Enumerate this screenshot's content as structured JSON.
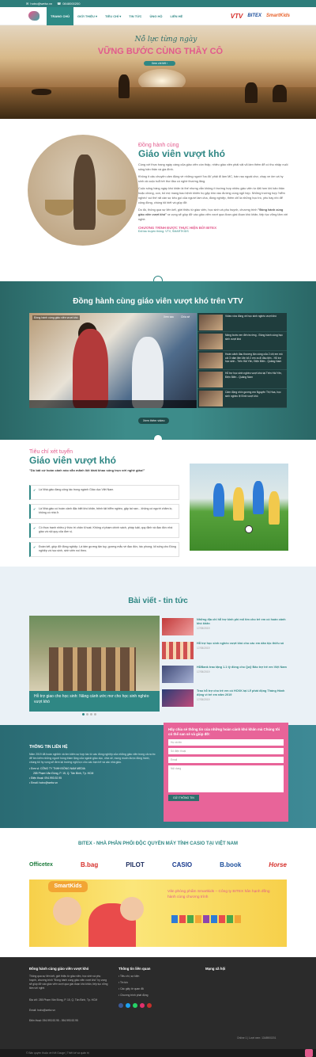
{
  "topbar": {
    "email": "hotro@webz.vn",
    "phone": "0848000200"
  },
  "nav": {
    "items": [
      "TRANG CHỦ",
      "GIỚI THIỆU ▾",
      "TIÊU CHÍ ▾",
      "TIN TỨC",
      "ỦNG HỘ",
      "LIÊN HỆ"
    ],
    "brands": [
      "VTV",
      "BITEX",
      "SmartKids"
    ]
  },
  "hero": {
    "script": "Nỗ lực từng ngày",
    "title": "VỮNG BƯỚC CÙNG THẦY CÔ",
    "button": "Xem chi tiết ›"
  },
  "intro": {
    "subtitle": "Đồng hành cùng",
    "title": "Giáo viên vượt khó",
    "p1": "Cùng với thực trạng ngày càng của giáo viên còn thấp, nhiều giáo viên phải vật vã làm thêm để có thu nhập nuôi sống bản thân và gia đình.",
    "p2": "Không ít câu chuyện cảm động về những người 'ba đô' phải đi làm MC, bán rau ngoài chợ, chạy xe ôm và hy sinh cả cuộc tuổi trẻ thơ đầu có nghề thường lãng.",
    "p3": "Cuộc sống hàng ngày khó khăn là thế nhưng vẫn không ít trường hợp nhiều giáo viên tư đất hơn khi bản thân hoặc chồng, con, bố mẹ mang bao bệnh khiến họ gặp khó vào đường cùng ngõ hẹp. Những trường hợp 'hiểm nghèo' vui thế rất cần sự kêu gọi của người làm cha, đồng nghiệp, thêm chỉ là những học trò, yêu hay nhì để cộng đồng, chúng tôi biết và giúp đỡ.",
    "p4": "Do đó, thông qua sự liên kết, giới thiệu từ giáo viên, học sinh và phụ huynh, chương trình",
    "p4b": "\"Đồng hành cùng giáo viên vượt khó\"",
    "p4c": "ra vọng sẽ giúp đỡ các giáo viên vượt qua được giai đoạn khó khăn, tiếp tục vững tâm với nghề.",
    "program": "CHƯƠNG TRÌNH ĐƯỢC THỰC HIỆN BỞI BITEX",
    "program_sub": "Đối tác truyền thông: VTV, SMARTKIDS"
  },
  "vtv": {
    "title": "Đồng hành cùng giáo viên vượt khó trên VTV",
    "video_title": "Đồng hành cùng giáo viên vượt khó",
    "watch_later": "Xem sau",
    "share": "Chia sẻ",
    "more_button": "Xem thêm video",
    "playlist": [
      "Video vừa đồng về học sinh nghèo vượt khó",
      "Nâng bước em đến trường - Đồng hành cùng học sinh vượt khó",
      "Hoàn cảnh đau thương tận cùng của 2 chị em mồ côi 3 năm liền Mẹ bỏ 2 em ra đi đầu tiên - Hỗ trợ học sinh - Trên Hải Yên, Điện Biên - Quảng Nam",
      "Hỗ trợ học sinh nghèo vượt khó tại Trên Hải Yên, Điện Biên - Quảng Nam",
      "Cảm động nhìn gương em Nguyên Thị Hoa, học sinh nghèo lệ Đình vượt khó"
    ]
  },
  "criteria": {
    "subtitle": "Tiêu chí xét tuyển",
    "title": "Giáo viên vượt khó",
    "quote": "\"Dù bất cứ hoàn cảnh nào vẫn mãnh liệt khát khao sống trọn với nghề giáo!\"",
    "items": [
      "Là Nhà giáo đang công tác trong ngành Giáo dục Việt Nam.",
      "Là Nhà giáo có hoàn cảnh đặc biệt khó khăn, bệnh tật hiểm nghèo, gặp tai nạn... không có người chăm lo, không có nhà ở.",
      "Có thực trạnh nhiều ý thức trí chân tị hoạt. Không vi phạm chính sách, pháp luật, quy định và đạo đức nhà giáo và nội quy của đơn vị.",
      "Đoàn kết, giúp đỡ đồng nghiệp. Là tấm gương tận tụy, gương mẫu về đạo đức, tác phong; lối sống cho Đồng nghiệp và học sinh, sinh viên noi theo."
    ]
  },
  "news": {
    "title": "Bài viết - tin tức",
    "main_caption": "Hỗ trợ giao cho học sinh: Nâng cánh ước mơ cho học sinh nghèo vượt khó",
    "items": [
      {
        "title": "Những địa chỉ hỗ trợ kinh phí mổ tim cho trẻ em có hoàn cảnh khó khăn",
        "date": "17/05/2019"
      },
      {
        "title": "Hỗ trợ học sinh nghèo vượt khó cho các em dân tộc thiểu số",
        "date": "17/05/2019"
      },
      {
        "title": "HDBank trao tặng 1.1 tỷ đồng cho Quỹ Bảo trợ trẻ em Việt Nam",
        "date": "17/05/2019"
      },
      {
        "title": "Trao hỗ trợ cho trẻ em có HCKK tại Lễ phát động Tháng Hành động vì trẻ em năm 2019",
        "date": "17/05/2019"
      }
    ]
  },
  "contact": {
    "title": "THÔNG TIN LIÊN HỆ",
    "desc": "Năm 2019 đã hoàn nghĩnh và tìm kiếm sự hợp tác từ các đồng nghiệp của những giáo viên trong cả nước để tìm kiếm những người hùng thầm lặng của ngành giáo dục, chia sẻ, mong muốn được đồng hành, chúng tôi hy vọng sẽ đem lại trường nghị lực cho các bạn trẻ và các nhà giáo.",
    "company": "Đơn vị: CÔNG TY TNHH ĐỒNG NAM MEDIA",
    "address": "285 Phạm Văn Đồng, P. 15, Q. Tân Bình, Tp. HCM",
    "phone": "Điện thoại: 094.993.92.95",
    "email": "Email: hotro@webz.vn",
    "form_title": "Hãy chia sẻ thông tin của những hoàn cảnh khó khăn mà Chúng tôi có thể san sẻ và giúp đỡ:",
    "f_name": "Họ và tên",
    "f_phone": "Số điện thoại",
    "f_email": "Email",
    "f_msg": "Nội dung",
    "f_button": "GỬI THÔNG TIN"
  },
  "distributors": {
    "title": "BITEX - NHÀ PHÂN PHỐI ĐỘC QUYỀN MÁY TÍNH CASIO TẠI VIỆT NAM",
    "logos": [
      "Officetex",
      "B.bag",
      "PILOT",
      "CASIO",
      "B.book",
      "Horse"
    ]
  },
  "banner": {
    "brand": "SmartKids",
    "text": "Văn phòng phẩm Smartkids – Công ty BITEX hân hạnh đồng hành cùng chương trình"
  },
  "footer": {
    "col1_title": "Đồng hành cùng giáo viên vượt khó",
    "col1_text": "Thông qua sự liên kết, giới thiệu từ giáo viên, học sinh và phụ huynh, chương trình \"Đồng hành cùng giáo viên vượt khó\" hy vọng sẽ giúp đỡ các giáo viên vượt qua giai đoạn khó khăn, tiếp tục vững tâm với nghề.",
    "col1_addr": "Địa chỉ: 285 Phạm Văn Đồng, P. 15, Q. Tân Bình, Tp. HCM",
    "col1_email": "Email: hotro@webz.vn",
    "col1_phone": "Điện thoại: 094.993.92.95 - 094.993.92.95",
    "col2_title": "Thông tin liên quan",
    "col2_links": [
      "Tiêu chí, sự kiện",
      "Tin tức",
      "Các giấy tờ quan đã",
      "Chương trình phát động"
    ],
    "col3_title": "Mạng xã hội",
    "copyright": "© Bản quyền thuộc về Kết Gauge | Thiết kế và quản trị",
    "online": "Online 1 | Lượt xem: 1348900201"
  },
  "colors": {
    "teal": "#2f8784",
    "pink": "#e25a8c",
    "footer": "#2b2b2b"
  }
}
